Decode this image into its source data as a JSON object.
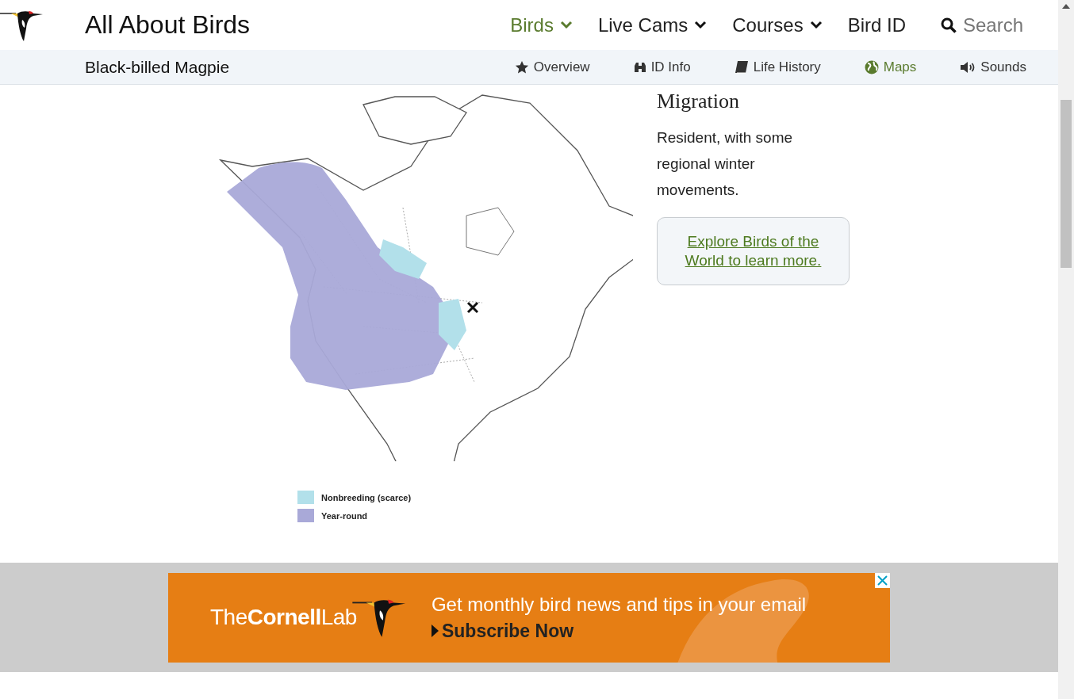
{
  "header": {
    "site_title": "All About Birds",
    "menu": [
      {
        "label": "Birds",
        "dropdown": true,
        "selected": true
      },
      {
        "label": "Live Cams",
        "dropdown": true,
        "selected": false
      },
      {
        "label": "Courses",
        "dropdown": true,
        "selected": false
      },
      {
        "label": "Bird ID",
        "dropdown": false,
        "selected": false
      }
    ],
    "search": {
      "placeholder": "Search"
    }
  },
  "subnav": {
    "species": "Black-billed Magpie",
    "tabs": [
      {
        "label": "Overview",
        "kind": "star",
        "selected": false
      },
      {
        "label": "ID Info",
        "kind": "binoculars",
        "selected": false
      },
      {
        "label": "Life History",
        "kind": "book",
        "selected": false
      },
      {
        "label": "Maps",
        "kind": "globe",
        "selected": true
      },
      {
        "label": "Sounds",
        "kind": "speaker",
        "selected": false
      }
    ]
  },
  "range_map": {
    "legend": [
      {
        "label": "Nonbreeding (scarce)",
        "color": "#b2e0ea"
      },
      {
        "label": "Year-round",
        "color": "#a9a9d8"
      }
    ]
  },
  "migration": {
    "heading": "Migration",
    "text": "Resident, with some regional winter movements.",
    "link": "Explore Birds of the World to learn more."
  },
  "ad": {
    "brand_light": "The",
    "brand_bold": "Cornell",
    "brand_end": "Lab",
    "headline": "Get monthly bird news and tips in your email",
    "cta": "Subscribe Now"
  }
}
